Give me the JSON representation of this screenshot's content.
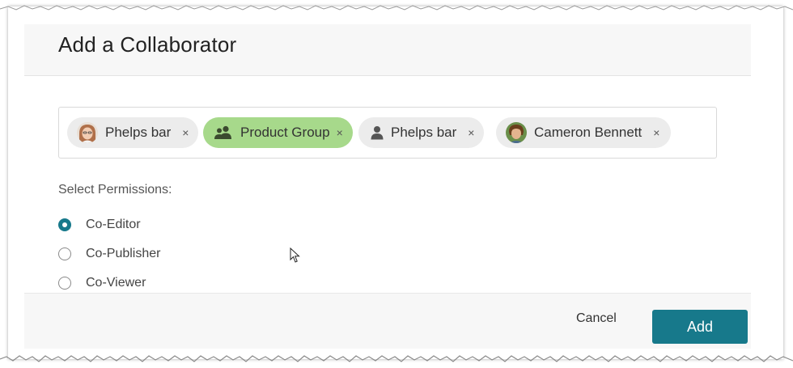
{
  "dialog": {
    "title": "Add a Collaborator"
  },
  "collaborators": [
    {
      "label": "Phelps bar",
      "type": "user-photo",
      "selected": false,
      "remove": "×"
    },
    {
      "label": "Product Group",
      "type": "group",
      "selected": true,
      "remove": "×"
    },
    {
      "label": "Phelps bar",
      "type": "user-generic",
      "selected": false,
      "remove": "×"
    },
    {
      "label": "Cameron Bennett",
      "type": "user-photo",
      "selected": false,
      "remove": "×"
    }
  ],
  "permissions": {
    "label": "Select Permissions:",
    "options": [
      {
        "label": "Co-Editor",
        "checked": true
      },
      {
        "label": "Co-Publisher",
        "checked": false
      },
      {
        "label": "Co-Viewer",
        "checked": false
      }
    ]
  },
  "footer": {
    "cancel_label": "Cancel",
    "add_label": "Add"
  },
  "colors": {
    "accent": "#17798b",
    "selected_chip": "#a7d98b",
    "chip": "#ececec"
  }
}
